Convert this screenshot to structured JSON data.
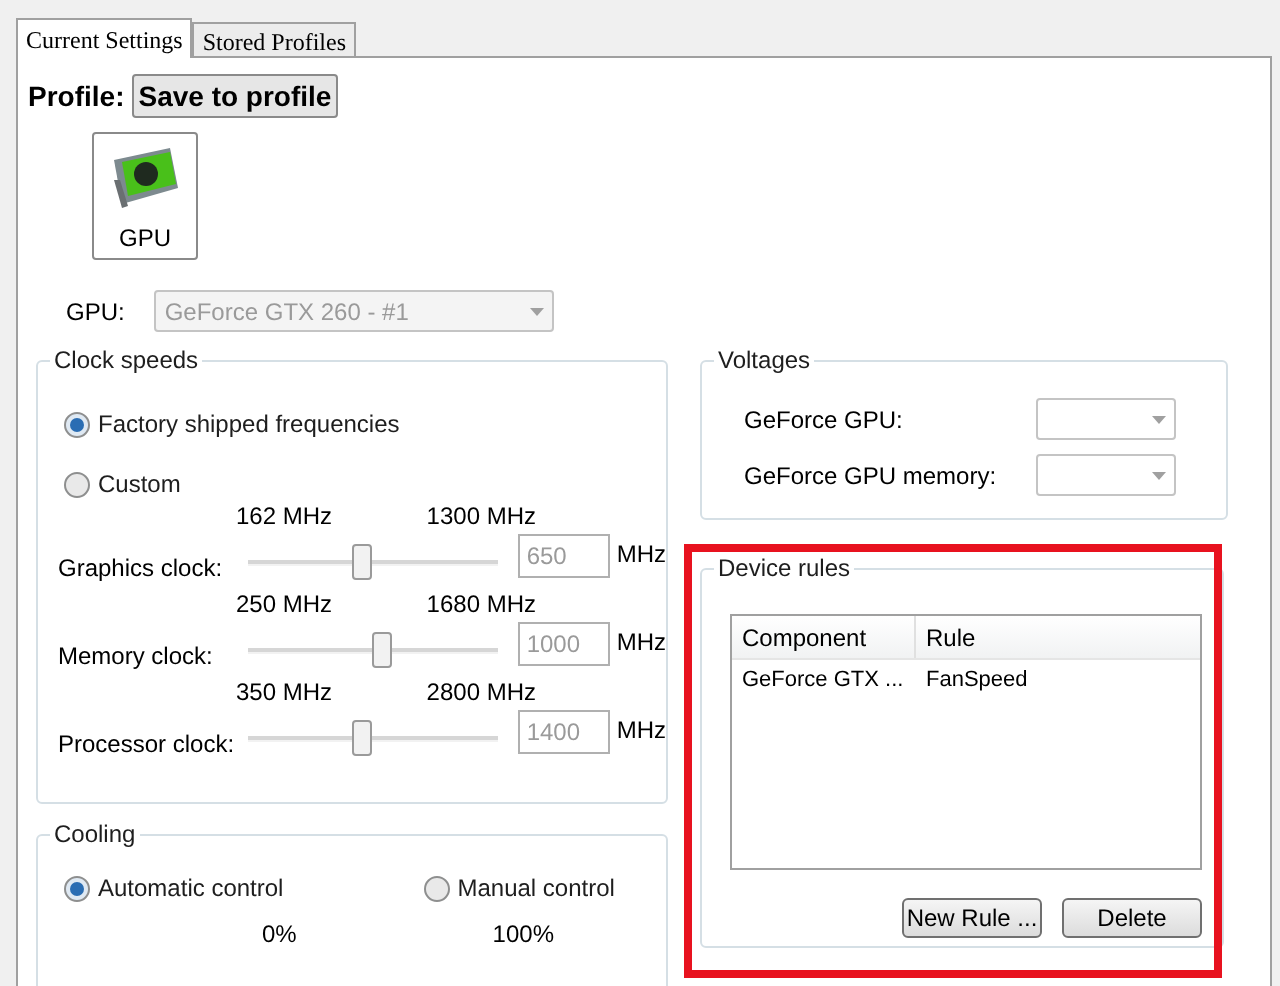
{
  "tabs": [
    {
      "label": "Current Settings",
      "selected": true
    },
    {
      "label": "Stored Profiles",
      "selected": false
    }
  ],
  "profile": {
    "label": "Profile:",
    "save_button": "Save to profile"
  },
  "device": {
    "label": "GPU",
    "selected": true
  },
  "gpu_select": {
    "label": "GPU:",
    "value": "GeForce GTX 260 - #1",
    "disabled": true
  },
  "clock_speeds": {
    "title": "Clock speeds",
    "modes": [
      {
        "label": "Factory shipped frequencies",
        "selected": true
      },
      {
        "label": "Custom",
        "selected": false
      }
    ],
    "clocks": [
      {
        "name": "Graphics clock:",
        "min": "162 MHz",
        "max": "1300 MHz",
        "level": 0.44,
        "value": "650",
        "unit": "MHz"
      },
      {
        "name": "Memory clock:",
        "min": "250 MHz",
        "max": "1680 MHz",
        "level": 0.52,
        "value": "1000",
        "unit": "MHz"
      },
      {
        "name": "Processor clock:",
        "min": "350 MHz",
        "max": "2800 MHz",
        "level": 0.44,
        "value": "1400",
        "unit": "MHz"
      }
    ]
  },
  "cooling": {
    "title": "Cooling",
    "modes": [
      {
        "label": "Automatic control",
        "selected": true
      },
      {
        "label": "Manual control",
        "selected": false
      }
    ],
    "min": "0%",
    "max": "100%"
  },
  "voltages": {
    "title": "Voltages",
    "rows": [
      {
        "label": "GeForce GPU:"
      },
      {
        "label": "GeForce GPU memory:"
      }
    ]
  },
  "device_rules": {
    "title": "Device rules",
    "highlighted": true,
    "columns": [
      "Component",
      "Rule"
    ],
    "rows": [
      [
        "GeForce GTX ...",
        "FanSpeed"
      ]
    ],
    "buttons": [
      "New Rule ...",
      "Delete"
    ]
  }
}
